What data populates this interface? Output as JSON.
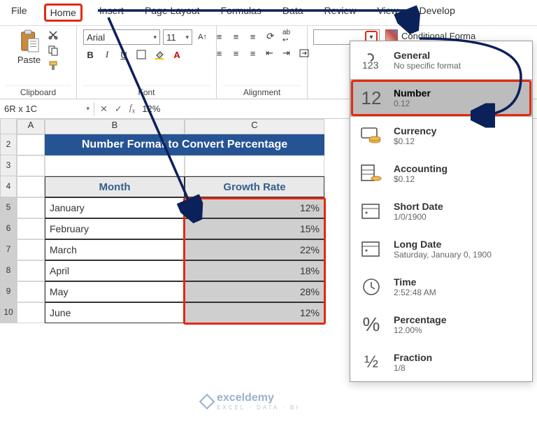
{
  "menu": {
    "file": "File",
    "home": "Home",
    "insert": "Insert",
    "page_layout": "Page Layout",
    "formulas": "Formulas",
    "data": "Data",
    "review": "Review",
    "view": "View",
    "develop": "Develop"
  },
  "ribbon": {
    "paste_label": "Paste",
    "clipboard_label": "Clipboard",
    "font_name": "Arial",
    "font_size": "11",
    "bold": "B",
    "italic": "I",
    "underline": "U",
    "font_label": "Font",
    "align_label": "Alignment",
    "number_format_current": "",
    "cond_format_label": "Conditional Forma"
  },
  "namebox": {
    "ref": "6R x 1C"
  },
  "formula_bar": {
    "value": "12%"
  },
  "sheet": {
    "col_a": "A",
    "col_b": "B",
    "col_c": "C",
    "rows": [
      "2",
      "3",
      "4",
      "5",
      "6",
      "7",
      "8",
      "9",
      "10"
    ],
    "title": "Number Format to Convert Percentage",
    "header_b": "Month",
    "header_c": "Growth Rate",
    "data": [
      {
        "month": "January",
        "rate": "12%"
      },
      {
        "month": "February",
        "rate": "15%"
      },
      {
        "month": "March",
        "rate": "22%"
      },
      {
        "month": "April",
        "rate": "18%"
      },
      {
        "month": "May",
        "rate": "28%"
      },
      {
        "month": "June",
        "rate": "12%"
      }
    ]
  },
  "dropdown": {
    "general": {
      "title": "General",
      "sub": "No specific format"
    },
    "number": {
      "title": "Number",
      "sub": "0.12"
    },
    "currency": {
      "title": "Currency",
      "sub": "$0.12"
    },
    "accounting": {
      "title": "Accounting",
      "sub": "$0.12"
    },
    "short_date": {
      "title": "Short Date",
      "sub": "1/0/1900"
    },
    "long_date": {
      "title": "Long Date",
      "sub": "Saturday, January 0, 1900"
    },
    "time": {
      "title": "Time",
      "sub": "2:52:48 AM"
    },
    "percentage": {
      "title": "Percentage",
      "sub": "12.00%"
    },
    "fraction": {
      "title": "Fraction",
      "sub": "1/8"
    }
  },
  "watermark": {
    "brand": "exceldemy",
    "tag": "EXCEL · DATA · BI"
  }
}
